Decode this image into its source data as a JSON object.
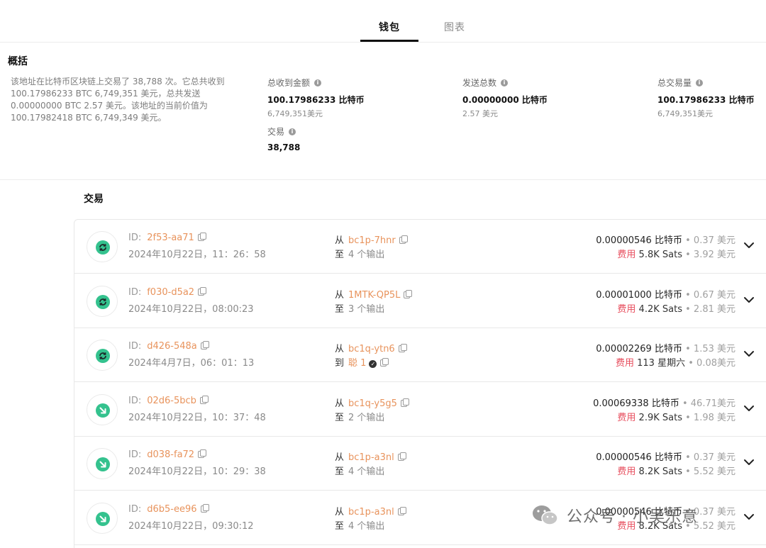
{
  "tabs": {
    "wallet": "钱包",
    "chart": "图表"
  },
  "overview": {
    "title": "概括",
    "description_lines": [
      "该地址在比特币区块链上交易了 38,788 次。它总共收到",
      "100.17986233 BTC 6,749,351 美元，总共发送",
      "0.00000000 BTC 2.57 美元。该地址的当前价值为",
      "100.17982418 BTC 6,749,349 美元。"
    ],
    "stats": {
      "received": {
        "label": "总收到金额",
        "value": "100.17986233 比特币",
        "sub": "6,749,351美元"
      },
      "sent": {
        "label": "发送总数",
        "value": "0.00000000 比特币",
        "sub": "2.57 美元"
      },
      "volume": {
        "label": "总交易量",
        "value": "100.17986233 比特币",
        "sub": "6,749,351美元"
      },
      "tx_count": {
        "label": "交易",
        "value": "38,788"
      }
    }
  },
  "transactions_title": "交易",
  "labels": {
    "id_prefix": "ID:",
    "from": "从",
    "to_out": "至",
    "to_addr": "到",
    "fee": "费用",
    "dot": "•"
  },
  "colors": {
    "accent_orange": "#e8935c",
    "fee_red": "#e74c5c",
    "icon_green": "#34c28e"
  },
  "transactions": [
    {
      "icon": "swap-icon",
      "id": "2f53-aa71",
      "date": "2024年10月22日，11：26：58",
      "from": "bc1p-7hnr",
      "to_lead": "至",
      "to": "4 个输出",
      "amount": "0.00000546 比特币",
      "amount_usd": "0.37 美元",
      "fee": "5.8K Sats",
      "fee_usd": "3.92 美元"
    },
    {
      "icon": "swap-icon",
      "id": "f030-d5a2",
      "date": "2024年10月22日，08:00:23",
      "from": "1MTK-QP5L",
      "to_lead": "至",
      "to": "3 个输出",
      "amount": "0.00001000 比特币",
      "amount_usd": "0.67 美元",
      "fee": "4.2K Sats",
      "fee_usd": "2.81 美元"
    },
    {
      "icon": "swap-icon",
      "id": "d426-548a",
      "date": "2024年4月7日，06：01：13",
      "from": "bc1q-ytn6",
      "to_lead": "到",
      "to": "聪 1",
      "amount": "0.00002269 比特币",
      "amount_usd": "1.53 美元",
      "fee": "113 星期六",
      "fee_usd": "0.08美元"
    },
    {
      "icon": "receive-icon",
      "id": "02d6-5bcb",
      "date": "2024年10月22日，10：37：48",
      "from": "bc1q-y5g5",
      "to_lead": "至",
      "to": "2 个输出",
      "amount": "0.00069338 比特币",
      "amount_usd": "46.71美元",
      "fee": "2.9K Sats",
      "fee_usd": "1.98 美元"
    },
    {
      "icon": "receive-icon",
      "id": "d038-fa72",
      "date": "2024年10月22日，10：29：38",
      "from": "bc1p-a3nl",
      "to_lead": "至",
      "to": "4 个输出",
      "amount": "0.00000546 比特币",
      "amount_usd": "0.37 美元",
      "fee": "8.2K Sats",
      "fee_usd": "5.52 美元"
    },
    {
      "icon": "receive-icon",
      "id": "d6b5-ee96",
      "date": "2024年10月22日，09:30:12",
      "from": "bc1p-a3nl",
      "to_lead": "至",
      "to": "4 个输出",
      "amount": "0.00000546 比特币",
      "amount_usd": "0.37 美元",
      "fee": "8.2K Sats",
      "fee_usd": "5.52 美元"
    }
  ],
  "watermark": "公众号 · 小吴乐意"
}
